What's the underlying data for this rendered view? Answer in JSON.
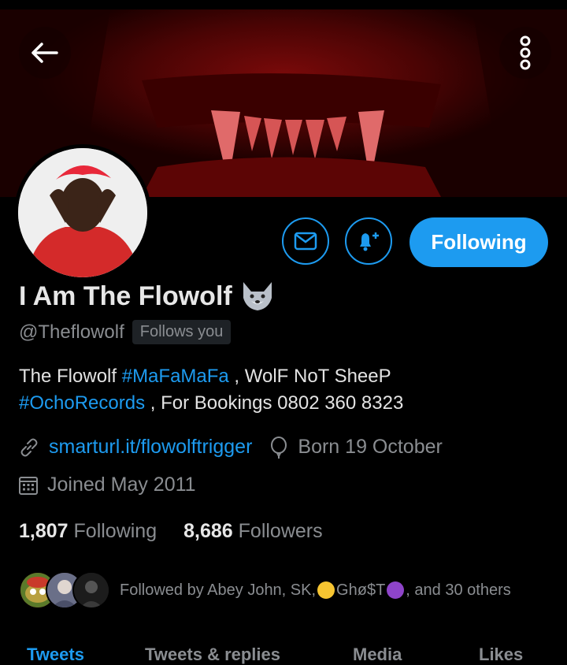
{
  "header": {
    "back_icon": "arrow-left-icon",
    "more_icon": "more-vertical-icon"
  },
  "profile": {
    "display_name": "I Am The Flowolf",
    "name_emoji": "wolf-face",
    "handle": "@Theflowolf",
    "follows_you_badge": "Follows you",
    "bio_parts": [
      "The Flowolf ",
      "#MaFaMaFa",
      " , WolF NoT SheeP",
      "#OchoRecords",
      " , For Bookings 0802 360 8323"
    ],
    "website": "smarturl.it/flowolftrigger",
    "birthday": "Born 19 October",
    "joined": "Joined May 2011",
    "following_count": "1,807",
    "following_label": "Following",
    "followers_count": "8,686",
    "followers_label": "Followers",
    "followed_by_prefix": "Followed by Abey John, SK, ",
    "followed_by_name": "Ghø$T",
    "followed_by_suffix": ", and 30 others"
  },
  "actions": {
    "message_icon": "mail-icon",
    "notify_icon": "bell-plus-icon",
    "following_button": "Following"
  },
  "tabs": [
    "Tweets",
    "Tweets & replies",
    "Media",
    "Likes"
  ],
  "colors": {
    "accent": "#1d9bf0",
    "muted": "#8a8d91",
    "background": "#000000"
  }
}
